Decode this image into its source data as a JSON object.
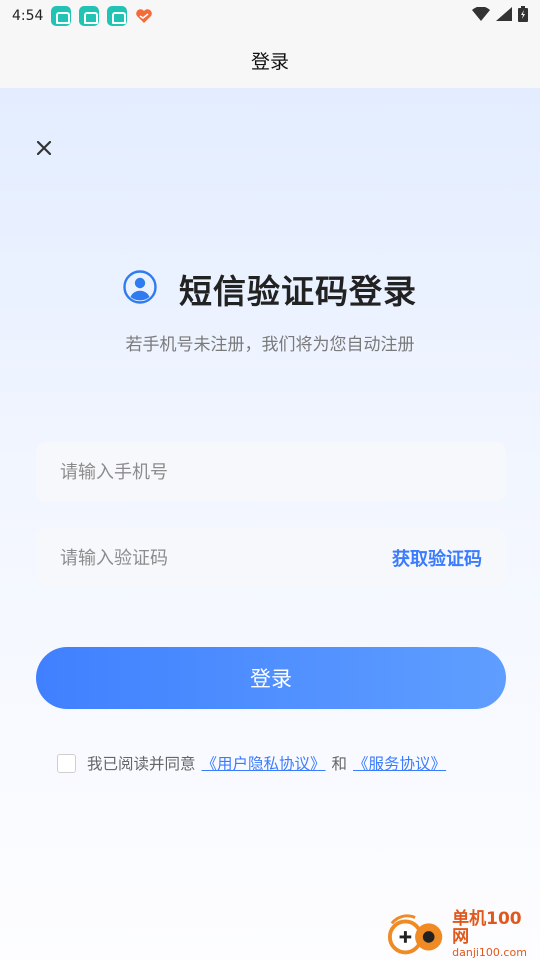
{
  "status_bar": {
    "time": "4:54",
    "app_icons": [
      "car-app-icon",
      "car-app-icon",
      "car-app-icon",
      "heart-app-icon"
    ],
    "right_icons": [
      "wifi-icon",
      "signal-icon",
      "battery-icon"
    ]
  },
  "header": {
    "title": "登录"
  },
  "close_icon": "close-icon",
  "heading": {
    "icon": "user-avatar-icon",
    "title": "短信验证码登录",
    "subtitle": "若手机号未注册，我们将为您自动注册"
  },
  "form": {
    "phone_placeholder": "请输入手机号",
    "phone_value": "",
    "code_placeholder": "请输入验证码",
    "code_value": "",
    "get_code_label": "获取验证码",
    "login_label": "登录"
  },
  "agreement": {
    "checked": false,
    "prefix": "我已阅读并同意",
    "user_privacy_link": "《用户隐私协议》",
    "and_text": "和",
    "service_link": "《服务协议》"
  },
  "watermark": {
    "title": "单机100网",
    "url": "danji100.com"
  },
  "colors": {
    "accent": "#3b7cff",
    "button_start": "#4080ff",
    "button_end": "#5f9eff",
    "status_app_icon": "#21c3b5"
  }
}
